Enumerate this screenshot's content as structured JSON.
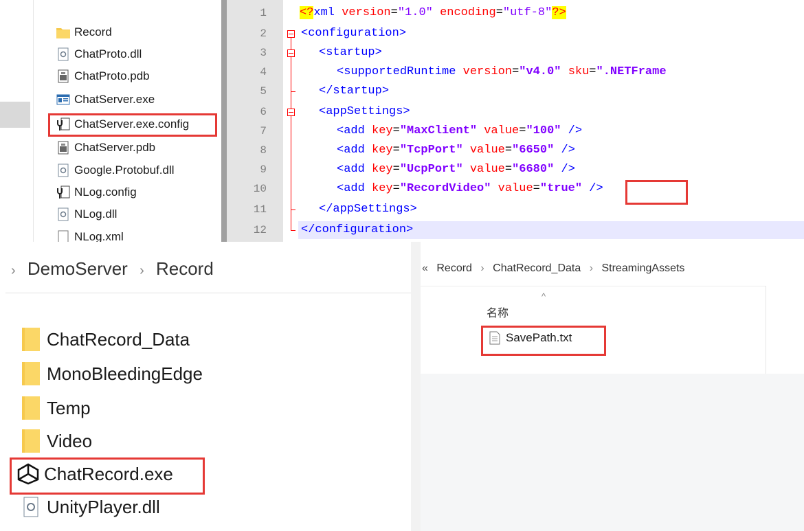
{
  "top_file_list": {
    "items": [
      {
        "name": "Record",
        "icon": "folder-icon"
      },
      {
        "name": "ChatProto.dll",
        "icon": "dll-file-icon"
      },
      {
        "name": "ChatProto.pdb",
        "icon": "pdb-file-icon"
      },
      {
        "name": "ChatServer.exe",
        "icon": "exe-file-icon"
      },
      {
        "name": "ChatServer.exe.config",
        "icon": "config-file-icon"
      },
      {
        "name": "ChatServer.pdb",
        "icon": "pdb-file-icon"
      },
      {
        "name": "Google.Protobuf.dll",
        "icon": "dll-file-icon"
      },
      {
        "name": "NLog.config",
        "icon": "config-file-icon"
      },
      {
        "name": "NLog.dll",
        "icon": "dll-file-icon"
      },
      {
        "name": "NLog.xml",
        "icon": "xml-file-icon"
      }
    ]
  },
  "code_editor": {
    "line_numbers": [
      "1",
      "2",
      "3",
      "4",
      "5",
      "6",
      "7",
      "8",
      "9",
      "10",
      "11",
      "12"
    ],
    "line1": {
      "pi_open": "<?",
      "xml": "xml ",
      "version_attr": "version",
      "eq1": "=",
      "version_val": "\"1.0\"",
      "sp": " ",
      "encoding_attr": "encoding",
      "eq2": "=",
      "encoding_val": "\"utf-8\"",
      "pi_close": "?>"
    },
    "line2": "<configuration>",
    "line3": "<startup>",
    "line4": {
      "tag": "<supportedRuntime ",
      "version_attr": "version",
      "eq": "=",
      "version_val": "\"v4.0\"",
      "sp": " ",
      "sku_attr": "sku",
      "eq2": "=",
      "sku_val": "\".NETFrame"
    },
    "line5": "</startup>",
    "line6": "<appSettings>",
    "settings": [
      {
        "tag": "<add ",
        "key_attr": "key",
        "key_val": "\"MaxClient\"",
        "value_attr": "value",
        "value_val": "\"100\"",
        "close": " />"
      },
      {
        "tag": "<add ",
        "key_attr": "key",
        "key_val": "\"TcpPort\"",
        "value_attr": "value",
        "value_val": "\"6650\"",
        "close": " />"
      },
      {
        "tag": "<add ",
        "key_attr": "key",
        "key_val": "\"UcpPort\"",
        "value_attr": "value",
        "value_val": "\"6680\"",
        "close": " />"
      },
      {
        "tag": "<add ",
        "key_attr": "key",
        "key_val": "\"RecordVideo\"",
        "value_attr": "value",
        "value_val": "\"true\"",
        "close": " />"
      }
    ],
    "eq": "=",
    "sp": " ",
    "line11": "</appSettings>",
    "line12": "</configuration>"
  },
  "left_explorer": {
    "breadcrumb": {
      "chev1": "›",
      "part1": "DemoServer",
      "chev2": "›",
      "part2": "Record"
    },
    "items": [
      {
        "name": "ChatRecord_Data",
        "icon": "folder-icon"
      },
      {
        "name": "MonoBleedingEdge",
        "icon": "folder-icon"
      },
      {
        "name": "Temp",
        "icon": "folder-icon"
      },
      {
        "name": "Video",
        "icon": "folder-icon"
      },
      {
        "name": "ChatRecord.exe",
        "icon": "unity-icon"
      },
      {
        "name": "UnityPlayer.dll",
        "icon": "dll-file-icon"
      }
    ]
  },
  "right_explorer": {
    "breadcrumb": {
      "overflow": "«",
      "part1": "Record",
      "chev1": "›",
      "part2": "ChatRecord_Data",
      "chev2": "›",
      "part3": "StreamingAssets"
    },
    "column_header": "名称",
    "sort_glyph": "^",
    "file": {
      "name": "SavePath.txt",
      "icon": "text-file-icon"
    }
  },
  "colors": {
    "highlight_box": "#e53935",
    "xml_string": "#8000ff",
    "xml_attr": "#ff0000",
    "xml_tag": "#0000ff"
  }
}
